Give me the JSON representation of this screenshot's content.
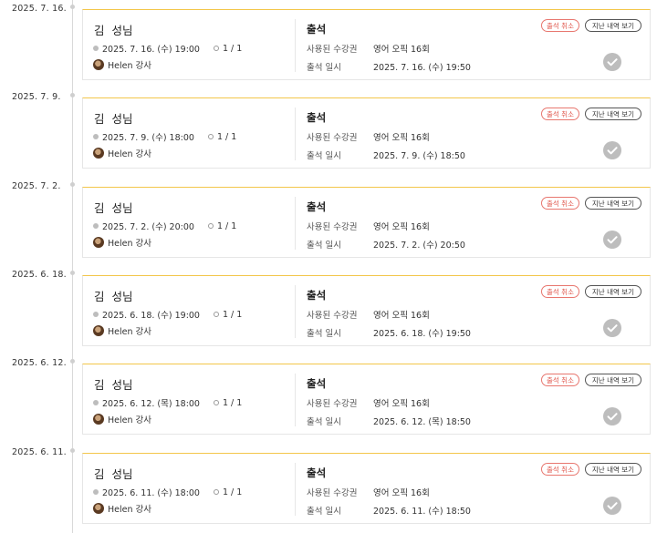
{
  "labels": {
    "status": "출석",
    "used_pass_label": "사용된 수강권",
    "attend_time_label": "출석 일시",
    "cancel_button": "출석 취소",
    "history_button": "지난 내역 보기"
  },
  "icons": {
    "time": "clock-icon",
    "capacity": "person-icon",
    "teacher": "avatar",
    "status": "check-circle-icon"
  },
  "colors": {
    "card_top_border": "#f3c64a",
    "cancel": "#e0584e",
    "check": "#bdbdbd"
  },
  "entries": [
    {
      "date": "2025. 7. 16.",
      "student": "김  성님",
      "class_time": "2025. 7. 16. (수) 19:00",
      "capacity": "1 / 1",
      "teacher": "Helen 강사",
      "pass": "영어 오픽 16회",
      "attended_at": "2025. 7. 16. (수) 19:50"
    },
    {
      "date": "2025. 7. 9.",
      "student": "김  성님",
      "class_time": "2025. 7. 9. (수) 18:00",
      "capacity": "1 / 1",
      "teacher": "Helen 강사",
      "pass": "영어 오픽 16회",
      "attended_at": "2025. 7. 9. (수) 18:50"
    },
    {
      "date": "2025. 7. 2.",
      "student": "김  성님",
      "class_time": "2025. 7. 2. (수) 20:00",
      "capacity": "1 / 1",
      "teacher": "Helen 강사",
      "pass": "영어 오픽 16회",
      "attended_at": "2025. 7. 2. (수) 20:50"
    },
    {
      "date": "2025. 6. 18.",
      "student": "김  성님",
      "class_time": "2025. 6. 18. (수) 19:00",
      "capacity": "1 / 1",
      "teacher": "Helen 강사",
      "pass": "영어 오픽 16회",
      "attended_at": "2025. 6. 18. (수) 19:50"
    },
    {
      "date": "2025. 6. 12.",
      "student": "김  성님",
      "class_time": "2025. 6. 12. (목) 18:00",
      "capacity": "1 / 1",
      "teacher": "Helen 강사",
      "pass": "영어 오픽 16회",
      "attended_at": "2025. 6. 12. (목) 18:50"
    },
    {
      "date": "2025. 6. 11.",
      "student": "김  성님",
      "class_time": "2025. 6. 11. (수) 18:00",
      "capacity": "1 / 1",
      "teacher": "Helen 강사",
      "pass": "영어 오픽 16회",
      "attended_at": "2025. 6. 11. (수) 18:50"
    }
  ]
}
